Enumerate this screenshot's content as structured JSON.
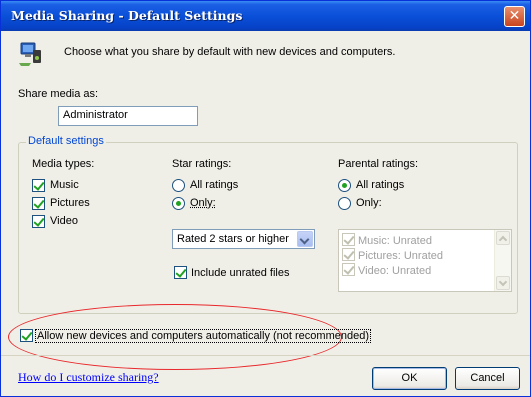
{
  "window": {
    "title": "Media Sharing - Default Settings",
    "close_glyph": "✕"
  },
  "header": {
    "description": "Choose what you share by default with new devices and computers."
  },
  "share_as": {
    "label": "Share media as:",
    "value": "Administrator"
  },
  "default_settings": {
    "label": "Default settings",
    "media_types": {
      "label": "Media types:",
      "items": [
        {
          "label": "Music",
          "checked": true
        },
        {
          "label": "Pictures",
          "checked": true
        },
        {
          "label": "Video",
          "checked": true
        }
      ]
    },
    "star_ratings": {
      "label": "Star ratings:",
      "options": [
        {
          "label": "All ratings",
          "selected": false
        },
        {
          "label": "Only:",
          "selected": true
        }
      ],
      "dropdown_value": "Rated 2 stars or higher",
      "include_unrated": {
        "label": "Include unrated files",
        "checked": true
      }
    },
    "parental_ratings": {
      "label": "Parental ratings:",
      "options": [
        {
          "label": "All ratings",
          "selected": true
        },
        {
          "label": "Only:",
          "selected": false
        }
      ],
      "list": [
        {
          "label": "Music: Unrated",
          "checked": true
        },
        {
          "label": "Pictures: Unrated",
          "checked": true
        },
        {
          "label": "Video: Unrated",
          "checked": true
        }
      ]
    }
  },
  "allow_new": {
    "label": "Allow new devices and computers automatically (not recommended)",
    "checked": true
  },
  "footer": {
    "help_link": "How do I customize sharing?",
    "ok_label": "OK",
    "cancel_label": "Cancel"
  },
  "colors": {
    "titlebar": "#0a50d8",
    "group_label": "#0046d5",
    "highlight_ellipse": "#e8282c",
    "link": "#0000ff"
  }
}
